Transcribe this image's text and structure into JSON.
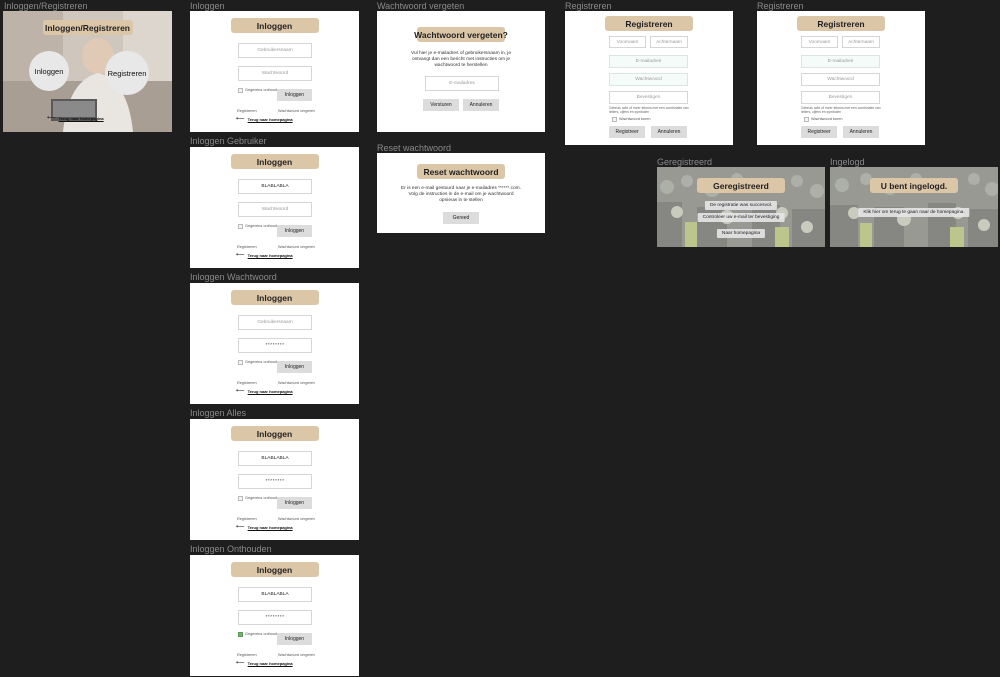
{
  "labels": {
    "inlog_reg": "Inloggen/Registreren",
    "inloggen": "Inloggen",
    "inloggen_gebruiker": "Inloggen Gebruiker",
    "inloggen_wachtwoord": "Inloggen Wachtwoord",
    "inloggen_alles": "Inloggen Alles",
    "inloggen_onthouden": "Inloggen Onthouden",
    "wachtwoord_vergeten": "Wachtwoord vergeten",
    "reset_wachtwoord": "Reset wachtwoord",
    "registreren1": "Registreren",
    "registreren2": "Registreren",
    "geregistreerd": "Geregistreerd",
    "ingelogd": "Ingelogd"
  },
  "landing": {
    "title": "Inloggen/Registreren",
    "login_circle": "Inloggen",
    "register_circle": "Registreren",
    "back": "Terug naar homepagina"
  },
  "login": {
    "title": "Inloggen",
    "username_placeholder": "Gebruikersnaam",
    "password_placeholder": "Wachtwoord",
    "username_filled": "BLABLABLA",
    "password_filled": "********",
    "remember": "Gegevens onthouden",
    "button": "Inloggen",
    "register_link": "Registreren",
    "forgot_link": "Wachtwoord vergeten",
    "back": "Terug naar homepagina"
  },
  "forgot": {
    "title": "Wachtwoord vergeten?",
    "text": "Vul hier je e-mailadres of gebruikersnaam in, je ontvangt dan een bericht met instructies om je wachtwoord te herstellen",
    "email_placeholder": "E-mailadres",
    "send": "Versturen",
    "cancel": "Annuleren"
  },
  "reset": {
    "title": "Reset wachtwoord",
    "text": "Er is een e-mail gestuurd naar je e-mailadres ******.com. Volg de instructies in de e-mail om je wachtwoord opnieuw in te stellen",
    "done": "Gereed"
  },
  "register": {
    "title": "Registreren",
    "first_name": "Voornaam",
    "last_name": "Achternaam",
    "email": "E-mailadres",
    "password": "Wachtwoord",
    "confirm": "Bevestigen",
    "hint": "Gebruik acht of meer tekens met een combinatie van letters, cijfers en symbolen",
    "show_password": "Wachtwoord tonen",
    "submit": "Registreer",
    "cancel": "Annuleren"
  },
  "registered": {
    "title": "Geregistreerd",
    "line1": "De registratie was succesvol.",
    "line2": "Controleer uw e-mail ter bevestiging",
    "button": "Naar homepagina"
  },
  "loggedin": {
    "title": "U bent ingelogd.",
    "line1": "Klik hier om terug te gaan naar de homepagina."
  },
  "colors": {
    "canvas": "#1e1e1e",
    "header": "#dcc6a8",
    "button": "#dcdcdc"
  }
}
